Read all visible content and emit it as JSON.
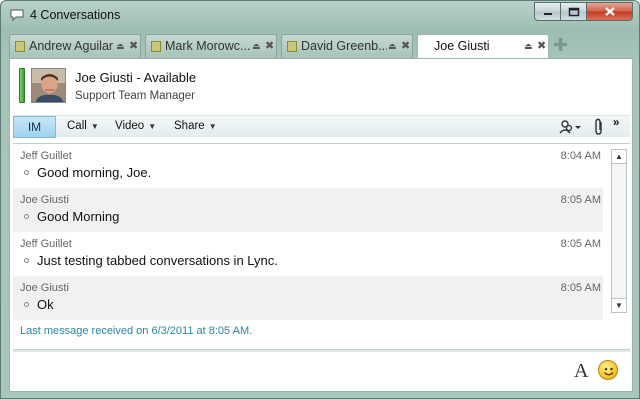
{
  "window": {
    "title": "4 Conversations"
  },
  "tabs": [
    {
      "label": "Andrew Aguilar"
    },
    {
      "label": "Mark Morowc..."
    },
    {
      "label": "David Greenb..."
    },
    {
      "label": "Joe Giusti"
    }
  ],
  "contact": {
    "name_status": "Joe Giusti - Available",
    "title": "Support Team Manager",
    "presence_color": "#3aa02f"
  },
  "toolbar": {
    "im_label": "IM",
    "call_label": "Call",
    "video_label": "Video",
    "share_label": "Share",
    "more_label": "»"
  },
  "messages": [
    {
      "sender": "Jeff Guillet",
      "time": "8:04 AM",
      "text": "Good morning, Joe."
    },
    {
      "sender": "Joe Giusti",
      "time": "8:05 AM",
      "text": "Good Morning"
    },
    {
      "sender": "Jeff Guillet",
      "time": "8:05 AM",
      "text": "Just testing tabbed conversations in Lync."
    },
    {
      "sender": "Joe Giusti",
      "time": "8:05 AM",
      "text": "Ok"
    }
  ],
  "status_line": "Last message received on 6/3/2011 at 8:05 AM.",
  "input": {
    "font_label": "A"
  }
}
